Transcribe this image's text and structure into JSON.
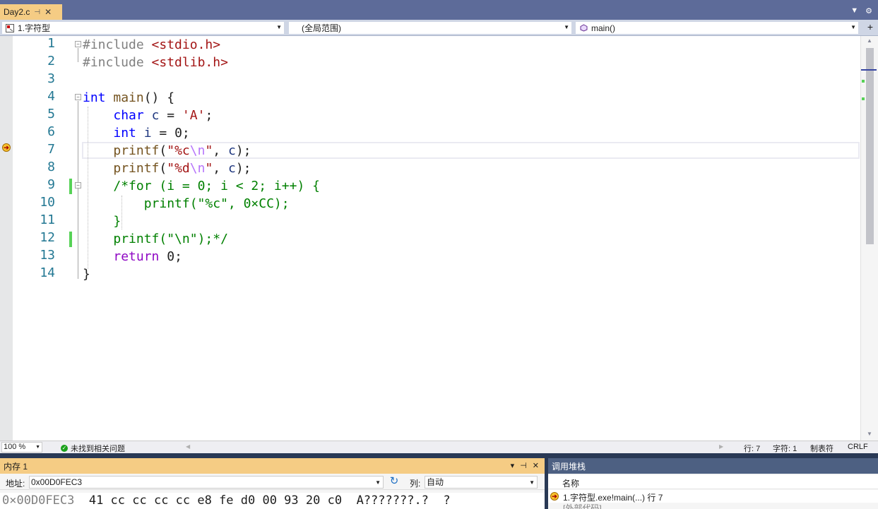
{
  "tab": {
    "title": "Day2.c",
    "pin": "⊣",
    "close": "✕"
  },
  "tabbar_controls": {
    "dropdown": "▼",
    "settings": "⚙"
  },
  "nav": {
    "project": "1.字符型",
    "scope": "(全局范围)",
    "member": "main()",
    "split": "+"
  },
  "editor": {
    "line_numbers": [
      "1",
      "2",
      "3",
      "4",
      "5",
      "6",
      "7",
      "8",
      "9",
      "10",
      "11",
      "12",
      "13",
      "14"
    ],
    "current_line": 7,
    "lines": {
      "l1_pp": "#include",
      "l1_hdr": "<stdio.h>",
      "l2_pp": "#include",
      "l2_hdr": "<stdlib.h>",
      "l4_kw": "int",
      "l4_fn": "main",
      "l4_rest": "() {",
      "l5_kw": "char",
      "l5_var": "c",
      "l5_eq": " = ",
      "l5_str": "'A'",
      "l5_end": ";",
      "l6_kw": "int",
      "l6_var": "i",
      "l6_rest": " = 0;",
      "l7_fn": "printf",
      "l7_open": "(",
      "l7_str1": "\"%c",
      "l7_esc": "\\n",
      "l7_str2": "\"",
      "l7_comma": ", ",
      "l7_var": "c",
      "l7_end": ");",
      "l8_fn": "printf",
      "l8_open": "(",
      "l8_str1": "\"%d",
      "l8_esc": "\\n",
      "l8_str2": "\"",
      "l8_comma": ", ",
      "l8_var": "c",
      "l8_end": ");",
      "l9_cmt": "/*for (i = 0; i < 2; i++) {",
      "l10_cmt": "printf(\"%c\", 0×CC);",
      "l11_cmt": "}",
      "l12_cmt": "printf(\"\\n\");*/",
      "l13_kw": "return",
      "l13_rest": " 0;",
      "l14": "}"
    }
  },
  "status": {
    "zoom": "100 %",
    "issues": "未找到相关问题",
    "line": "行: 7",
    "char": "字符: 1",
    "tabs": "制表符",
    "eol": "CRLF"
  },
  "memory": {
    "title": "内存 1",
    "ctrl_dropdown": "▾",
    "ctrl_pin": "⊣",
    "ctrl_close": "✕",
    "address_label": "地址:",
    "address_value": "0x00D0FEC3",
    "columns_label": "列:",
    "columns_value": "自动",
    "row_address": "0×00D0FEC3",
    "row_bytes": "41 cc cc cc cc e8 fe d0 00 93 20 c0",
    "row_ascii": "A???????.?  ?"
  },
  "callstack": {
    "title": "调用堆栈",
    "column_name": "名称",
    "frame1": "1.字符型.exe!main(...) 行 7",
    "frame2": "[外部代码]"
  },
  "colors": {
    "tab_active": "#f5cc84",
    "chrome": "#293955",
    "keyword": "#0000ff",
    "comment": "#008000",
    "string": "#a31515",
    "line_number": "#237893"
  }
}
